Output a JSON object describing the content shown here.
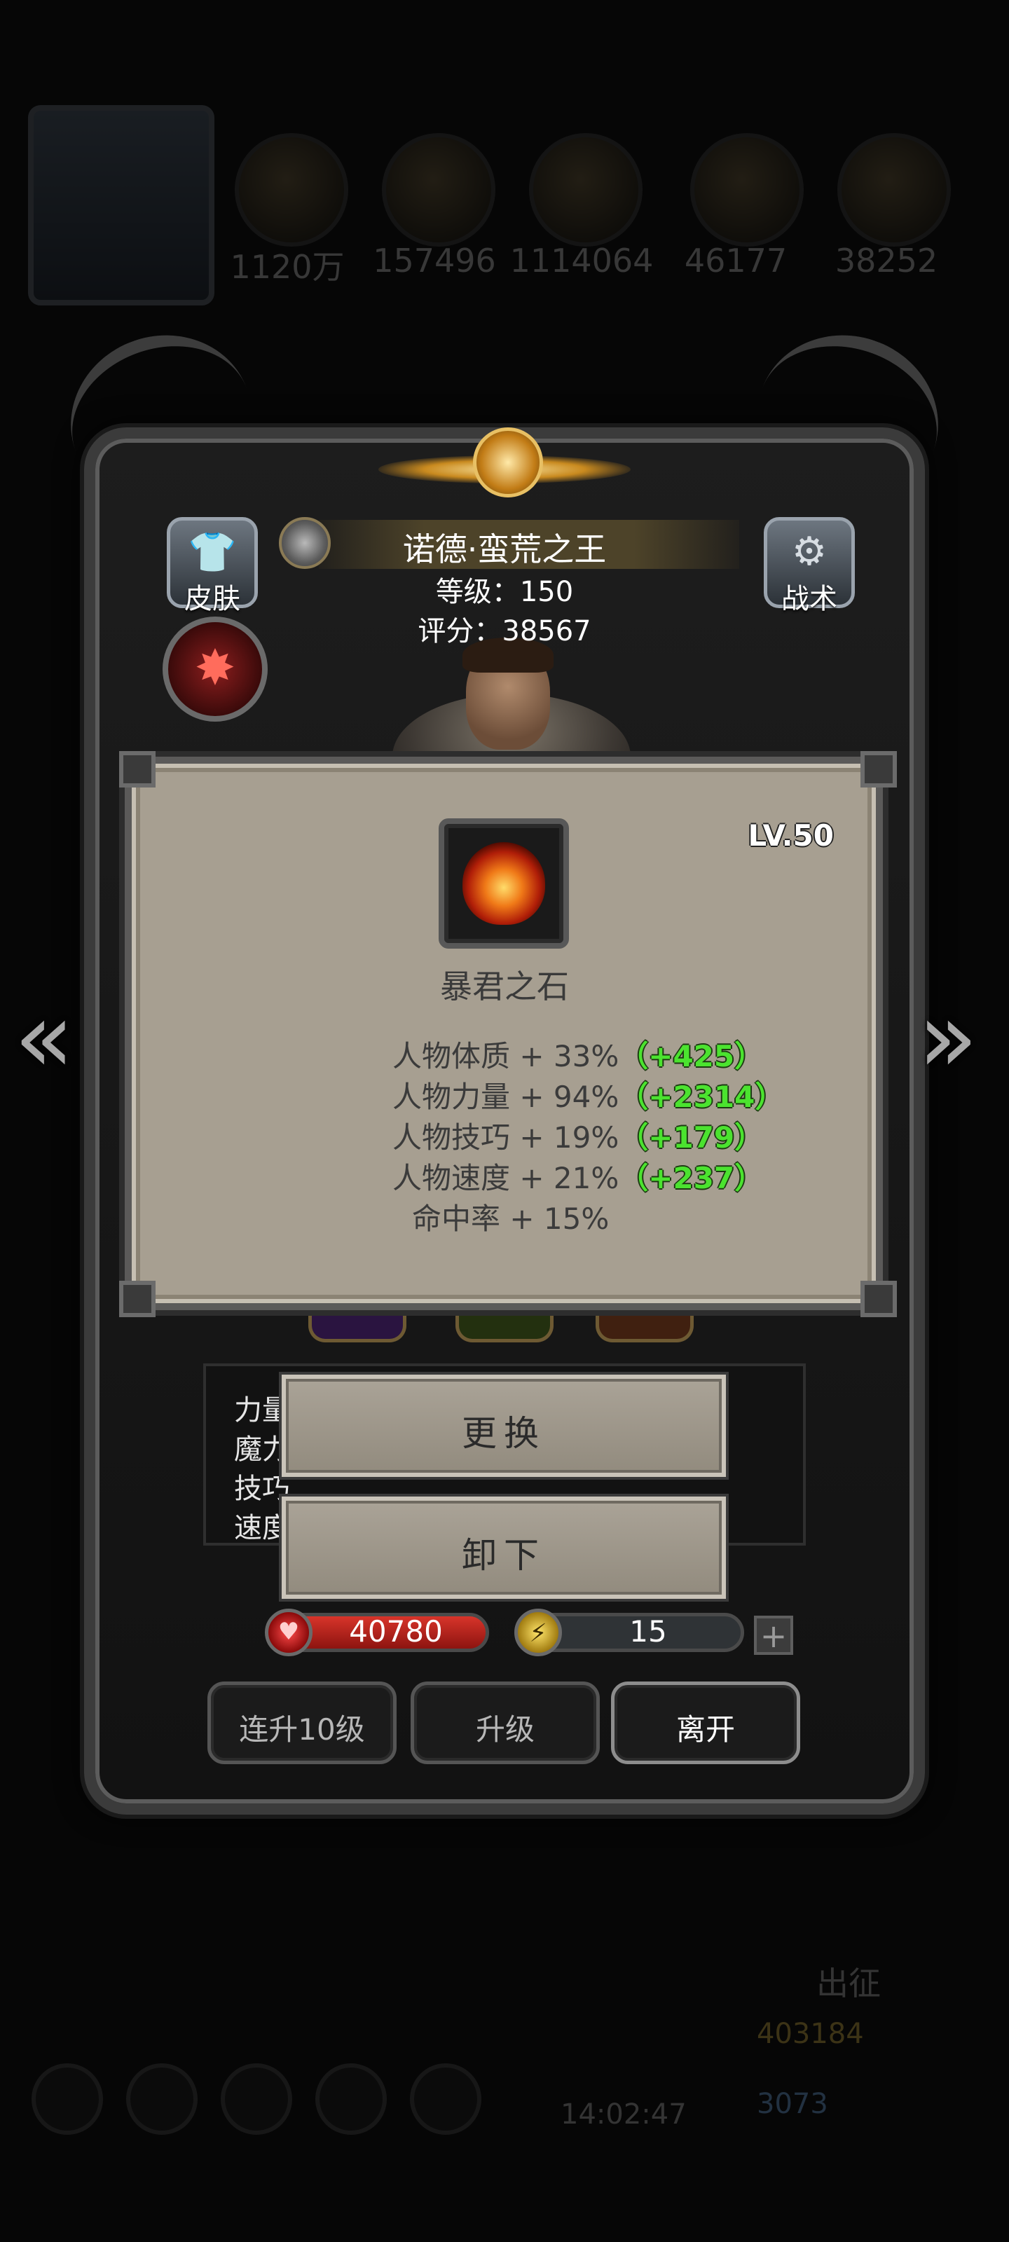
{
  "background": {
    "resources": [
      {
        "icon": "gold-coin-icon",
        "value": "1120万"
      },
      {
        "icon": "wood-icon",
        "value": "157496"
      },
      {
        "icon": "iron-icon",
        "value": "1114064"
      },
      {
        "icon": "crystal-icon",
        "value": "46177"
      },
      {
        "icon": "stone-icon",
        "value": "38252"
      }
    ],
    "expedition_label": "出征",
    "coins": "403184",
    "gems": "3073",
    "clock": "14:02:47"
  },
  "hero": {
    "skin_label": "皮肤",
    "tactic_label": "战术",
    "name": "诺德·蛮荒之王",
    "level_label": "等级：",
    "level": "150",
    "score_label": "评分：",
    "score": "38567"
  },
  "item": {
    "icon": "flame-stone-icon",
    "level": "LV.50",
    "name": "暴君之石",
    "stats": [
      {
        "label": "人物体质 + 33%",
        "bonus": "（+425）"
      },
      {
        "label": "人物力量 + 94%",
        "bonus": "（+2314）"
      },
      {
        "label": "人物技巧 + 19%",
        "bonus": "（+179）"
      },
      {
        "label": "人物速度 + 21%",
        "bonus": "（+237）"
      },
      {
        "label": "命中率 + 15%",
        "bonus": ""
      }
    ]
  },
  "hero_stats_stub": [
    "力量",
    "魔力",
    "技巧",
    "速度"
  ],
  "actions": {
    "replace": "更换",
    "unequip": "卸下"
  },
  "bars": {
    "hp": "40780",
    "energy": "15",
    "energy_fill": 0.12
  },
  "footer": {
    "level_up_10": "连升10级",
    "level_up": "升级",
    "leave": "离开"
  },
  "colors": {
    "bonus_green": "#4be32f",
    "card_bg": "#a79f91",
    "hp_red": "#d8342a",
    "energy_yellow": "#f4e17a"
  }
}
